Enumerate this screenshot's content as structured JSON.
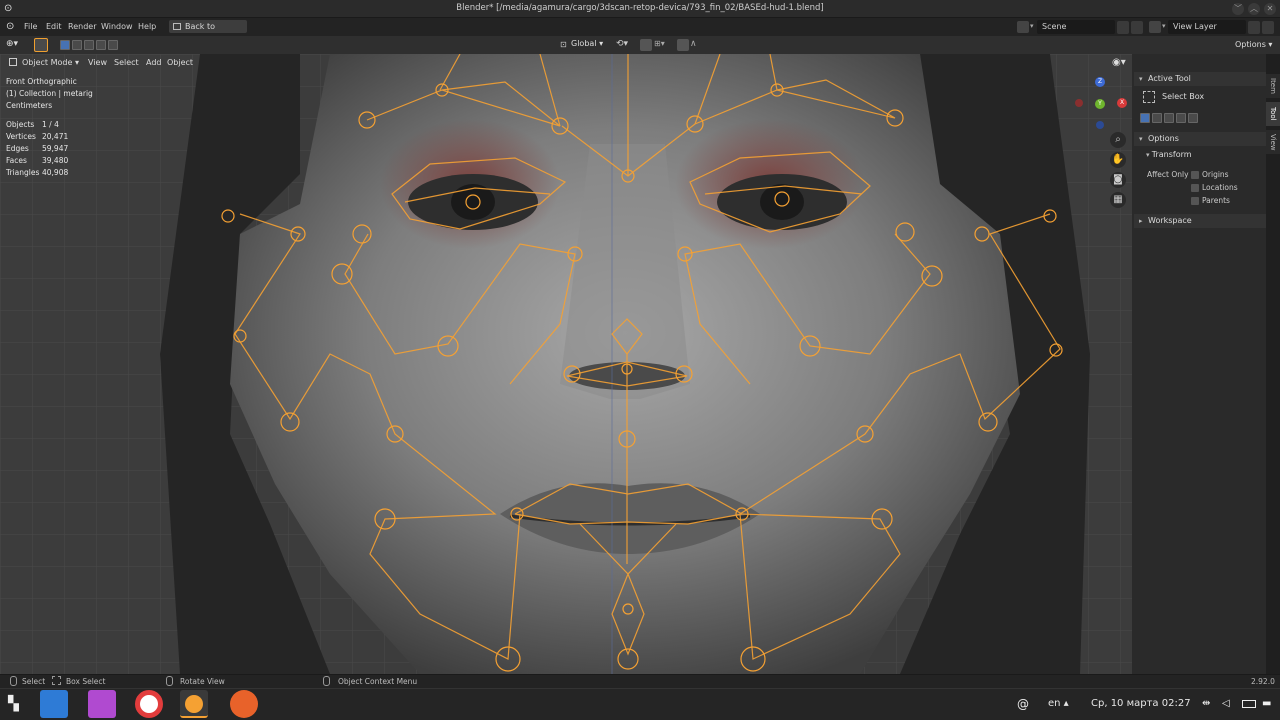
{
  "window": {
    "title": "Blender* [/media/agamura/cargo/3dscan-retop-devica/793_fin_02/BASEd-hud-1.blend]"
  },
  "menubar": {
    "items": [
      "File",
      "Edit",
      "Render",
      "Window",
      "Help"
    ],
    "back_button": "Back to Previous",
    "scene_label": "Scene",
    "view_layer_label": "View Layer"
  },
  "toolbar": {
    "transform_orientation": "Global",
    "options_label": "Options"
  },
  "viewport": {
    "mode": "Object Mode",
    "menus": [
      "View",
      "Select",
      "Add",
      "Object"
    ],
    "view_name": "Front Orthographic",
    "collection": "(1) Collection | metarig",
    "units": "Centimeters",
    "stats": [
      {
        "label": "Objects",
        "value": "1 / 4"
      },
      {
        "label": "Vertices",
        "value": "20,471"
      },
      {
        "label": "Edges",
        "value": "59,947"
      },
      {
        "label": "Faces",
        "value": "39,480"
      },
      {
        "label": "Triangles",
        "value": "40,908"
      }
    ],
    "accent_color": "#f5a133"
  },
  "npanel": {
    "active_tool_header": "Active Tool",
    "tool_name": "Select Box",
    "options_header": "Options",
    "transform_header": "Transform",
    "affect_only_label": "Affect Only",
    "affect_options": [
      "Origins",
      "Locations",
      "Parents"
    ],
    "workspace_header": "Workspace",
    "tabs": [
      "Item",
      "Tool",
      "View"
    ]
  },
  "statusbar": {
    "select": "Select",
    "box_select": "Box Select",
    "rotate_view": "Rotate View",
    "context_menu": "Object Context Menu",
    "version": "2.92.0"
  },
  "taskbar": {
    "lang": "en",
    "datetime": "Ср, 10 марта  02:27"
  }
}
